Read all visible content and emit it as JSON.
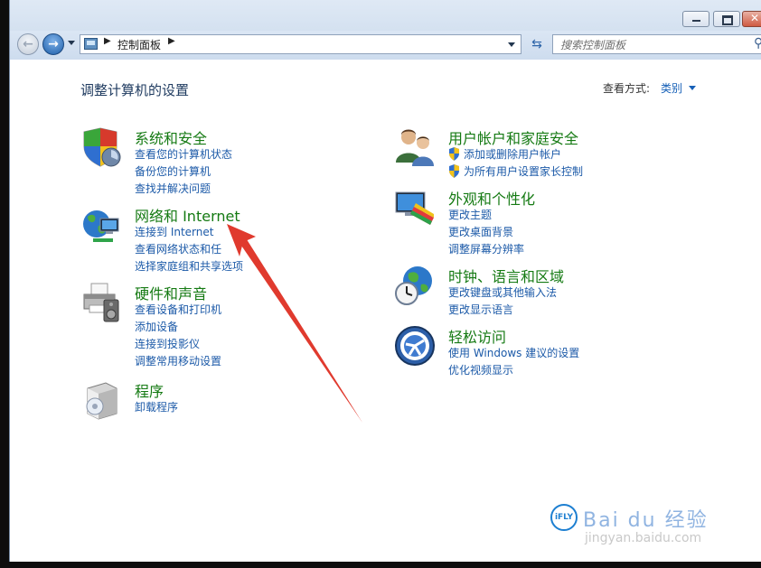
{
  "address": {
    "path": "控制面板",
    "search_placeholder": "搜索控制面板"
  },
  "header": {
    "title": "调整计算机的设置",
    "view_label": "查看方式:",
    "view_value": "类别"
  },
  "left_categories": [
    {
      "title": "系统和安全",
      "links": [
        "查看您的计算机状态",
        "备份您的计算机",
        "查找并解决问题"
      ]
    },
    {
      "title": "网络和 Internet",
      "links": [
        "连接到 Internet",
        "查看网络状态和任",
        "选择家庭组和共享选项"
      ]
    },
    {
      "title": "硬件和声音",
      "links": [
        "查看设备和打印机",
        "添加设备",
        "连接到投影仪",
        "调整常用移动设置"
      ]
    },
    {
      "title": "程序",
      "links": [
        "卸载程序"
      ]
    }
  ],
  "right_categories": [
    {
      "title": "用户帐户和家庭安全",
      "links": [
        "添加或删除用户帐户",
        "为所有用户设置家长控制"
      ]
    },
    {
      "title": "外观和个性化",
      "links": [
        "更改主题",
        "更改桌面背景",
        "调整屏幕分辨率"
      ]
    },
    {
      "title": "时钟、语言和区域",
      "links": [
        "更改键盘或其他输入法",
        "更改显示语言"
      ]
    },
    {
      "title": "轻松访问",
      "links": [
        "使用 Windows 建议的设置",
        "优化视频显示"
      ]
    }
  ],
  "watermark": {
    "badge": "iFLY",
    "text": "Bai du 经验",
    "url": "jingyan.baidu.com"
  },
  "colors": {
    "category_title": "#157a13",
    "link": "#1c5aa8",
    "annotation_arrow": "#e03a2e"
  }
}
